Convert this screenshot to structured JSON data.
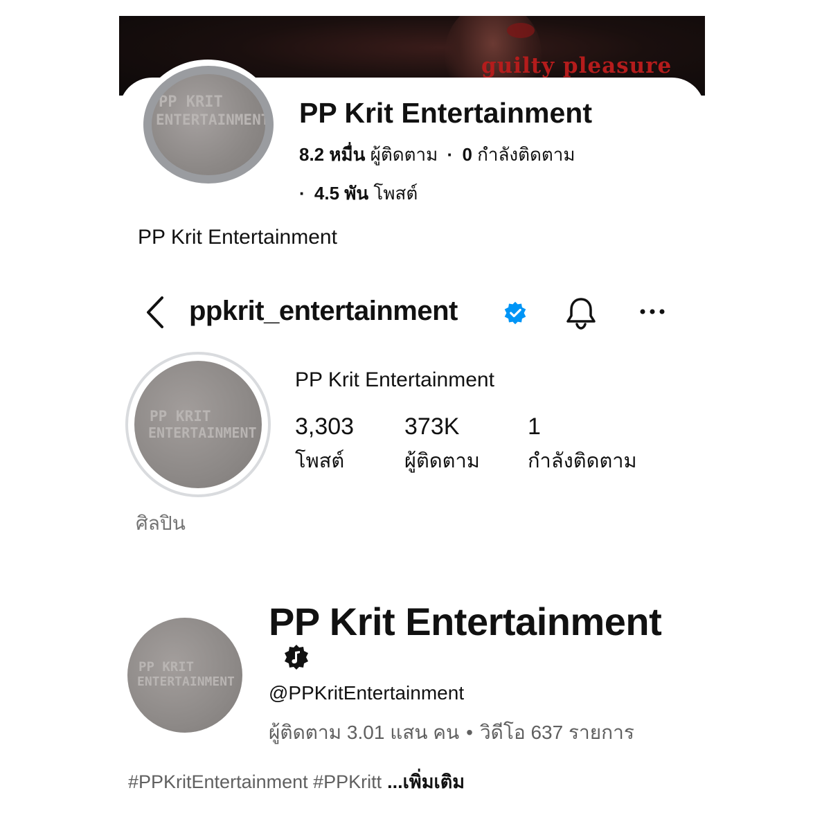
{
  "facebook": {
    "cover_text": "guilty pleasure",
    "avatar_watermark": [
      "PP KRIT",
      "ENTERTAINMENT"
    ],
    "page_title": "PP Krit Entertainment",
    "followers_value": "8.2 หมื่น",
    "followers_label": "ผู้ติดตาม",
    "following_value": "0",
    "following_label": "กำลังติดตาม",
    "posts_value": "4.5 พัน",
    "posts_label": "โพสต์",
    "separator": "·",
    "intro": "PP Krit Entertainment"
  },
  "instagram": {
    "back_icon": "chevron-left-icon",
    "handle": "ppkrit_entertainment",
    "verified_color": "#0095f6",
    "bell_icon": "bell-icon",
    "more_icon": "more-horizontal-icon",
    "avatar_watermark": [
      "PP KRIT",
      "ENTERTAINMENT"
    ],
    "display_name": "PP Krit Entertainment",
    "stats": [
      {
        "value": "3,303",
        "label": "โพสต์"
      },
      {
        "value": "373K",
        "label": "ผู้ติดตาม"
      },
      {
        "value": "1",
        "label": "กำลังติดตาม"
      }
    ],
    "category": "ศิลปิน"
  },
  "youtube": {
    "avatar_watermark": [
      "PP KRIT",
      "ENTERTAINMENT"
    ],
    "channel_name": "PP Krit Entertainment",
    "badge_icon": "music-note-badge-icon",
    "handle": "@PPKritEntertainment",
    "subscribers": "ผู้ติดตาม 3.01 แสน คน",
    "separator": "•",
    "videos": "วิดีโอ 637 รายการ",
    "description": "#PPKritEntertainment #PPKritt",
    "more_link": "...เพิ่มเติม"
  }
}
